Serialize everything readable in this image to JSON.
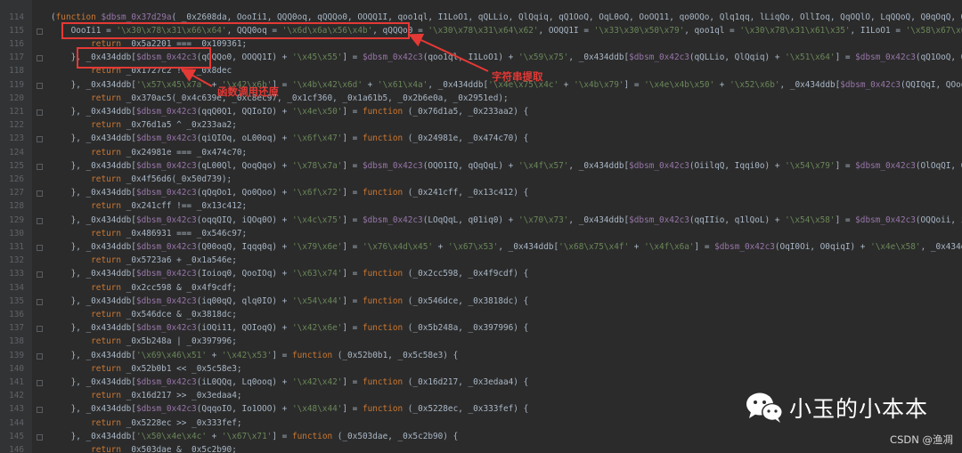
{
  "line_numbers": [
    "114",
    "115",
    "116",
    "117",
    "118",
    "119",
    "120",
    "121",
    "122",
    "123",
    "124",
    "125",
    "126",
    "127",
    "128",
    "129",
    "130",
    "131",
    "132",
    "133",
    "134",
    "135",
    "136",
    "137",
    "138",
    "139",
    "140",
    "141",
    "142",
    "143",
    "144",
    "145",
    "146"
  ],
  "annotations": {
    "string_extraction": "字符串提取",
    "func_call_restore": "函数调用还原"
  },
  "watermark": {
    "text": "小玉的小本本",
    "csdn": "CSDN @渔凋"
  },
  "code_lines": [
    [
      [
        "p",
        "("
      ],
      [
        "k",
        "function "
      ],
      [
        "v",
        "$dbsm_0x37d29a"
      ],
      [
        "p",
        "( _0x2608da, OooIi1, QQQ0oq, qQQQo0, OOQQ1I, qoo1ql, I1LoO1, qQLLio, QlQqiq, qQ1OoQ, OqL0oQ, OoOQ11, qo0OQo, Qlq1qq, lLiqQo, OllIoq, QqOQlO, LqQQoQ, Q0qOqQ, Q1I0qq, I1III"
      ]
    ],
    [
      [
        "p",
        "    OooIi1 = "
      ],
      [
        "s",
        "'\\x30\\x78\\x31\\x66\\x64'"
      ],
      [
        "p",
        ", QQQ0oq = "
      ],
      [
        "s",
        "'\\x6d\\x6a\\x56\\x4b'"
      ],
      [
        "p",
        ", qQQQo0 = "
      ],
      [
        "s",
        "'\\x30\\x78\\x31\\x64\\x62'"
      ],
      [
        "p",
        ", OOQQ1I = "
      ],
      [
        "s",
        "'\\x33\\x30\\x50\\x79'"
      ],
      [
        "p",
        ", qoo1ql = "
      ],
      [
        "s",
        "'\\x30\\x78\\x31\\x61\\x35'"
      ],
      [
        "p",
        ", I1LoO1 = "
      ],
      [
        "s",
        "'\\x58\\x67\\x61\\x6b'"
      ],
      [
        "p",
        ", qQLL"
      ]
    ],
    [
      [
        "p",
        "        "
      ],
      [
        "k",
        "return "
      ],
      [
        "p",
        "_0x5a2201 === _0x109361;"
      ]
    ],
    [
      [
        "p",
        "    }, _0x434ddb["
      ],
      [
        "v",
        "$dbsm_0x42c3"
      ],
      [
        "p",
        "(qQQQo0, OOQQ1I) + "
      ],
      [
        "s",
        "'\\x45\\x55'"
      ],
      [
        "p",
        "] = "
      ],
      [
        "v",
        "$dbsm_0x42c3"
      ],
      [
        "p",
        "(qoo1ql, I1LoO1) + "
      ],
      [
        "s",
        "'\\x59\\x75'"
      ],
      [
        "p",
        ", _0x434ddb["
      ],
      [
        "v",
        "$dbsm_0x42c3"
      ],
      [
        "p",
        "(qQLLio, QlQqiq) + "
      ],
      [
        "s",
        "'\\x51\\x64'"
      ],
      [
        "p",
        "] = "
      ],
      [
        "v",
        "$dbsm_0x42c3"
      ],
      [
        "p",
        "(qQ1OoQ, OqL0oQ) + "
      ],
      [
        "s",
        "'\\"
      ]
    ],
    [
      [
        "p",
        "        "
      ],
      [
        "k",
        "return "
      ],
      [
        "p",
        "_0x1727c2 !== _0x8dec"
      ]
    ],
    [
      [
        "p",
        "    }, _0x434ddb["
      ],
      [
        "s",
        "'\\x57\\x45\\x7a'"
      ],
      [
        "p",
        " + "
      ],
      [
        "s",
        "'\\x42\\x6b'"
      ],
      [
        "p",
        "] = "
      ],
      [
        "s",
        "'\\x4b\\x42\\x6d'"
      ],
      [
        "p",
        " + "
      ],
      [
        "s",
        "'\\x61\\x4a'"
      ],
      [
        "p",
        ", _0x434ddb["
      ],
      [
        "s",
        "'\\x4e\\x75\\x4c'"
      ],
      [
        "p",
        " + "
      ],
      [
        "s",
        "'\\x4b\\x79'"
      ],
      [
        "p",
        "] = "
      ],
      [
        "s",
        "'\\x4e\\x4b\\x50'"
      ],
      [
        "p",
        " + "
      ],
      [
        "s",
        "'\\x52\\x6b'"
      ],
      [
        "p",
        ", _0x434ddb["
      ],
      [
        "v",
        "$dbsm_0x42c3"
      ],
      [
        "p",
        "(QQIQqI, QOoqiq) + "
      ],
      [
        "s",
        "'\\x47"
      ]
    ],
    [
      [
        "p",
        "        "
      ],
      [
        "k",
        "return "
      ],
      [
        "p",
        "_0x370ac5(_0x4c639e, _0xc8ec97, _0x1cf360, _0x1a61b5, _0x2b6e0a, _0x2951ed);"
      ]
    ],
    [
      [
        "p",
        "    }, _0x434ddb["
      ],
      [
        "v",
        "$dbsm_0x42c3"
      ],
      [
        "p",
        "(qqQ0Q1, QQIoIO) + "
      ],
      [
        "s",
        "'\\x4e\\x50'"
      ],
      [
        "p",
        "] = "
      ],
      [
        "k",
        "function "
      ],
      [
        "p",
        "(_0x76d1a5, _0x233aa2) {"
      ]
    ],
    [
      [
        "p",
        "        "
      ],
      [
        "k",
        "return "
      ],
      [
        "p",
        "_0x76d1a5 ^ _0x233aa2;"
      ]
    ],
    [
      [
        "p",
        "    }, _0x434ddb["
      ],
      [
        "v",
        "$dbsm_0x42c3"
      ],
      [
        "p",
        "(qiQIOq, oL00oq) + "
      ],
      [
        "s",
        "'\\x6f\\x47'"
      ],
      [
        "p",
        "] = "
      ],
      [
        "k",
        "function "
      ],
      [
        "p",
        "(_0x24981e, _0x474c70) {"
      ]
    ],
    [
      [
        "p",
        "        "
      ],
      [
        "k",
        "return "
      ],
      [
        "p",
        "_0x24981e === _0x474c70;"
      ]
    ],
    [
      [
        "p",
        "    }, _0x434ddb["
      ],
      [
        "v",
        "$dbsm_0x42c3"
      ],
      [
        "p",
        "(qL00Ql, QoqQqo) + "
      ],
      [
        "s",
        "'\\x78\\x7a'"
      ],
      [
        "p",
        "] = "
      ],
      [
        "v",
        "$dbsm_0x42c3"
      ],
      [
        "p",
        "(OQO1IQ, qQqQqL) + "
      ],
      [
        "s",
        "'\\x4f\\x57'"
      ],
      [
        "p",
        ", _0x434ddb["
      ],
      [
        "v",
        "$dbsm_0x42c3"
      ],
      [
        "p",
        "(OiilqQ, Iqqi0o) + "
      ],
      [
        "s",
        "'\\x54\\x79'"
      ],
      [
        "p",
        "] = "
      ],
      [
        "v",
        "$dbsm_0x42c3"
      ],
      [
        "p",
        "(OlOqQI, Olql11) + "
      ],
      [
        "s",
        "'\\"
      ]
    ],
    [
      [
        "p",
        "        "
      ],
      [
        "k",
        "return "
      ],
      [
        "p",
        "_0x4f56d6(_0x50d739);"
      ]
    ],
    [
      [
        "p",
        "    }, _0x434ddb["
      ],
      [
        "v",
        "$dbsm_0x42c3"
      ],
      [
        "p",
        "(qQqOo1, Qo0Qoo) + "
      ],
      [
        "s",
        "'\\x6f\\x72'"
      ],
      [
        "p",
        "] = "
      ],
      [
        "k",
        "function "
      ],
      [
        "p",
        "(_0x241cff, _0x13c412) {"
      ]
    ],
    [
      [
        "p",
        "        "
      ],
      [
        "k",
        "return "
      ],
      [
        "p",
        "_0x241cff !== _0x13c412;"
      ]
    ],
    [
      [
        "p",
        "    }, _0x434ddb["
      ],
      [
        "v",
        "$dbsm_0x42c3"
      ],
      [
        "p",
        "(oqqQIQ, iQOq0O) + "
      ],
      [
        "s",
        "'\\x4c\\x75'"
      ],
      [
        "p",
        "] = "
      ],
      [
        "v",
        "$dbsm_0x42c3"
      ],
      [
        "p",
        "(LOqQqL, q01iq0) + "
      ],
      [
        "s",
        "'\\x70\\x73'"
      ],
      [
        "p",
        ", _0x434ddb["
      ],
      [
        "v",
        "$dbsm_0x42c3"
      ],
      [
        "p",
        "(qqIIio, q1lQoL) + "
      ],
      [
        "s",
        "'\\x54\\x58'"
      ],
      [
        "p",
        "] = "
      ],
      [
        "v",
        "$dbsm_0x42c3"
      ],
      [
        "p",
        "(OQQoii, i1QiOo) + "
      ],
      [
        "s",
        "'\\"
      ]
    ],
    [
      [
        "p",
        "        "
      ],
      [
        "k",
        "return "
      ],
      [
        "p",
        "_0x486931 === _0x546c97;"
      ]
    ],
    [
      [
        "p",
        "    }, _0x434ddb["
      ],
      [
        "v",
        "$dbsm_0x42c3"
      ],
      [
        "p",
        "(Q00oqQ, Iqqq0q) + "
      ],
      [
        "s",
        "'\\x79\\x6e'"
      ],
      [
        "p",
        "] = "
      ],
      [
        "s",
        "'\\x76\\x4d\\x45'"
      ],
      [
        "p",
        " + "
      ],
      [
        "s",
        "'\\x67\\x53'"
      ],
      [
        "p",
        ", _0x434ddb["
      ],
      [
        "s",
        "'\\x68\\x75\\x4f'"
      ],
      [
        "p",
        " + "
      ],
      [
        "s",
        "'\\x4f\\x6a'"
      ],
      [
        "p",
        "] = "
      ],
      [
        "v",
        "$dbsm_0x42c3"
      ],
      [
        "p",
        "(OqI0Oi, O0qiqI) + "
      ],
      [
        "s",
        "'\\x4e\\x58'"
      ],
      [
        "p",
        ", _0x434ddb["
      ],
      [
        "v",
        "$dbsm_0x"
      ]
    ],
    [
      [
        "p",
        "        "
      ],
      [
        "k",
        "return "
      ],
      [
        "p",
        "_0x5723a6 + _0x1a546e;"
      ]
    ],
    [
      [
        "p",
        "    }, _0x434ddb["
      ],
      [
        "v",
        "$dbsm_0x42c3"
      ],
      [
        "p",
        "(Ioioq0, QooIOq) + "
      ],
      [
        "s",
        "'\\x63\\x74'"
      ],
      [
        "p",
        "] = "
      ],
      [
        "k",
        "function "
      ],
      [
        "p",
        "(_0x2cc598, _0x4f9cdf) {"
      ]
    ],
    [
      [
        "p",
        "        "
      ],
      [
        "k",
        "return "
      ],
      [
        "p",
        "_0x2cc598 & _0x4f9cdf;"
      ]
    ],
    [
      [
        "p",
        "    }, _0x434ddb["
      ],
      [
        "v",
        "$dbsm_0x42c3"
      ],
      [
        "p",
        "(iq00qQ, qlq0IO) + "
      ],
      [
        "s",
        "'\\x54\\x44'"
      ],
      [
        "p",
        "] = "
      ],
      [
        "k",
        "function "
      ],
      [
        "p",
        "(_0x546dce, _0x3818dc) {"
      ]
    ],
    [
      [
        "p",
        "        "
      ],
      [
        "k",
        "return "
      ],
      [
        "p",
        "_0x546dce & _0x3818dc;"
      ]
    ],
    [
      [
        "p",
        "    }, _0x434ddb["
      ],
      [
        "v",
        "$dbsm_0x42c3"
      ],
      [
        "p",
        "(iOQi11, QOIoqQ) + "
      ],
      [
        "s",
        "'\\x42\\x6e'"
      ],
      [
        "p",
        "] = "
      ],
      [
        "k",
        "function "
      ],
      [
        "p",
        "(_0x5b248a, _0x397996) {"
      ]
    ],
    [
      [
        "p",
        "        "
      ],
      [
        "k",
        "return "
      ],
      [
        "p",
        "_0x5b248a | _0x397996;"
      ]
    ],
    [
      [
        "p",
        "    }, _0x434ddb["
      ],
      [
        "s",
        "'\\x69\\x46\\x51'"
      ],
      [
        "p",
        " + "
      ],
      [
        "s",
        "'\\x42\\x53'"
      ],
      [
        "p",
        "] = "
      ],
      [
        "k",
        "function "
      ],
      [
        "p",
        "(_0x52b0b1, _0x5c58e3) {"
      ]
    ],
    [
      [
        "p",
        "        "
      ],
      [
        "k",
        "return "
      ],
      [
        "p",
        "_0x52b0b1 << _0x5c58e3;"
      ]
    ],
    [
      [
        "p",
        "    }, _0x434ddb["
      ],
      [
        "v",
        "$dbsm_0x42c3"
      ],
      [
        "p",
        "(iL0QQq, Lq0ooq) + "
      ],
      [
        "s",
        "'\\x42\\x42'"
      ],
      [
        "p",
        "] = "
      ],
      [
        "k",
        "function "
      ],
      [
        "p",
        "(_0x16d217, _0x3edaa4) {"
      ]
    ],
    [
      [
        "p",
        "        "
      ],
      [
        "k",
        "return "
      ],
      [
        "p",
        "_0x16d217 >> _0x3edaa4;"
      ]
    ],
    [
      [
        "p",
        "    }, _0x434ddb["
      ],
      [
        "v",
        "$dbsm_0x42c3"
      ],
      [
        "p",
        "(QqqoIO, Io1OOO) + "
      ],
      [
        "s",
        "'\\x48\\x44'"
      ],
      [
        "p",
        "] = "
      ],
      [
        "k",
        "function "
      ],
      [
        "p",
        "(_0x5228ec, _0x333fef) {"
      ]
    ],
    [
      [
        "p",
        "        "
      ],
      [
        "k",
        "return "
      ],
      [
        "p",
        "_0x5228ec >> _0x333fef;"
      ]
    ],
    [
      [
        "p",
        "    }, _0x434ddb["
      ],
      [
        "s",
        "'\\x50\\x4e\\x4c'"
      ],
      [
        "p",
        " + "
      ],
      [
        "s",
        "'\\x67\\x71'"
      ],
      [
        "p",
        "] = "
      ],
      [
        "k",
        "function "
      ],
      [
        "p",
        "(_0x503dae, _0x5c2b90) {"
      ]
    ],
    [
      [
        "p",
        "        "
      ],
      [
        "k",
        "return "
      ],
      [
        "p",
        "_0x503dae & _0x5c2b90;"
      ]
    ]
  ]
}
